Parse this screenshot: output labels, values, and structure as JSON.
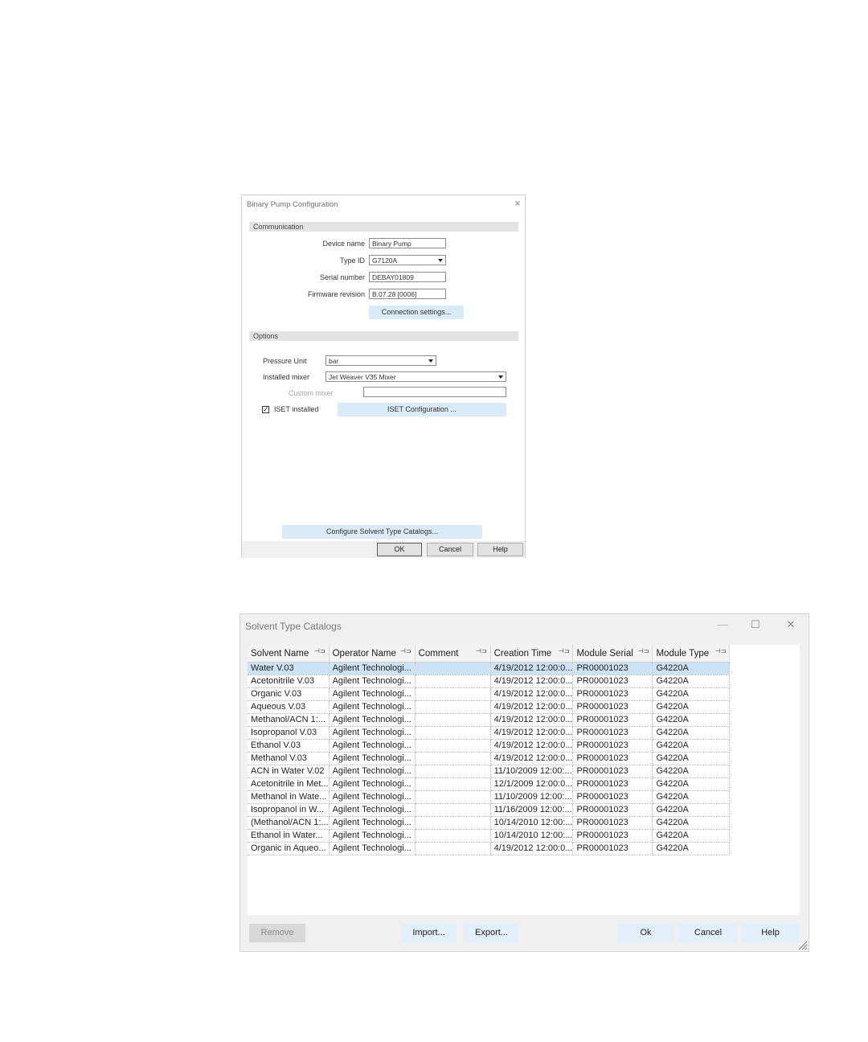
{
  "binary_pump_dialog": {
    "title": "Binary Pump Configuration",
    "close_glyph": "×",
    "communication": {
      "section_label": "Communication",
      "device_name_label": "Device name",
      "device_name_value": "Binary Pump",
      "type_id_label": "Type ID",
      "type_id_value": "G7120A",
      "serial_number_label": "Serial number",
      "serial_number_value": "DEBAY01809",
      "firmware_revision_label": "Firmware revision",
      "firmware_revision_value": "B.07.28 [0006]",
      "connection_settings_label": "Connection settings..."
    },
    "options": {
      "section_label": "Options",
      "pressure_unit_label": "Pressure Unit",
      "pressure_unit_value": "bar",
      "installed_mixer_label": "Installed mixer",
      "installed_mixer_value": "Jet Weaver V35 Mixer",
      "custom_mixer_label": "Custom mixer",
      "custom_mixer_value": "",
      "iset_installed_label": "ISET installed",
      "iset_installed_checked": true,
      "iset_configuration_label": "ISET Configuration ..."
    },
    "configure_catalogs_label": "Configure Solvent Type Catalogs...",
    "ok_label": "OK",
    "cancel_label": "Cancel",
    "help_label": "Help"
  },
  "catalog_dialog": {
    "title": "Solvent Type Catalogs",
    "minimize_glyph": "—",
    "maximize_glyph": "☐",
    "close_glyph": "✕",
    "pin_glyph": "⊣⊐",
    "columns": [
      "Solvent Name",
      "Operator Name",
      "Comment",
      "Creation Time",
      "Module Serial",
      "Module Type"
    ],
    "rows": [
      [
        "Water V.03",
        "Agilent Technologi...",
        "",
        "4/19/2012  12:00:0...",
        "PR00001023",
        "G4220A"
      ],
      [
        "Acetonitrile V.03",
        "Agilent Technologi...",
        "",
        "4/19/2012  12:00:0...",
        "PR00001023",
        "G4220A"
      ],
      [
        "Organic V.03",
        "Agilent Technologi...",
        "",
        "4/19/2012  12:00:0...",
        "PR00001023",
        "G4220A"
      ],
      [
        "Aqueous V.03",
        "Agilent Technologi...",
        "",
        "4/19/2012  12:00:0...",
        "PR00001023",
        "G4220A"
      ],
      [
        "Methanol/ACN  1:...",
        "Agilent Technologi...",
        "",
        "4/19/2012  12:00:0...",
        "PR00001023",
        "G4220A"
      ],
      [
        "Isopropanol V.03",
        "Agilent Technologi...",
        "",
        "4/19/2012  12:00:0...",
        "PR00001023",
        "G4220A"
      ],
      [
        "Ethanol V.03",
        "Agilent Technologi...",
        "",
        "4/19/2012  12:00:0...",
        "PR00001023",
        "G4220A"
      ],
      [
        "Methanol V.03",
        "Agilent Technologi...",
        "",
        "4/19/2012  12:00:0...",
        "PR00001023",
        "G4220A"
      ],
      [
        "ACN in Water V.02",
        "Agilent Technologi...",
        "",
        "11/10/2009  12:00:...",
        "PR00001023",
        "G4220A"
      ],
      [
        "Acetonitrile in Met...",
        "Agilent Technologi...",
        "",
        "12/1/2009  12:00:0...",
        "PR00001023",
        "G4220A"
      ],
      [
        "Methanol in Wate...",
        "Agilent Technologi...",
        "",
        "11/10/2009  12:00:...",
        "PR00001023",
        "G4220A"
      ],
      [
        "Isopropanol in W...",
        "Agilent Technologi...",
        "",
        "11/16/2009  12:00:...",
        "PR00001023",
        "G4220A"
      ],
      [
        "(Methanol/ACN  1:...",
        "Agilent Technologi...",
        "",
        "10/14/2010  12:00:...",
        "PR00001023",
        "G4220A"
      ],
      [
        "Ethanol in Water...",
        "Agilent Technologi...",
        "",
        "10/14/2010  12:00:...",
        "PR00001023",
        "G4220A"
      ],
      [
        "Organic in Aqueo...",
        "Agilent Technologi...",
        "",
        "4/19/2012  12:00:0...",
        "PR00001023",
        "G4220A"
      ]
    ],
    "selected_row": 0,
    "remove_label": "Remove",
    "import_label": "Import...",
    "export_label": "Export...",
    "ok_label": "Ok",
    "cancel_label": "Cancel",
    "help_label": "Help"
  },
  "colors": {
    "selection": "#cce2f6",
    "light_button": "#dbeaf7",
    "section_bar": "#e3e3e3"
  }
}
